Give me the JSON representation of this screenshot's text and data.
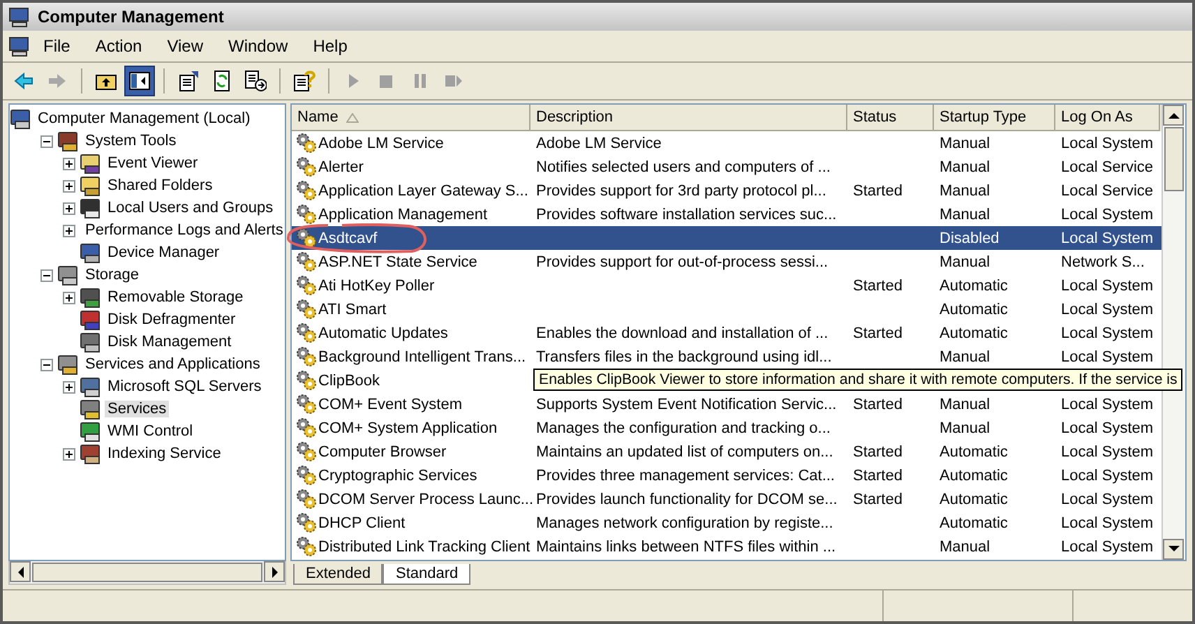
{
  "window": {
    "title": "Computer Management"
  },
  "menu": [
    "File",
    "Action",
    "View",
    "Window",
    "Help"
  ],
  "toolbar": [
    {
      "kind": "back",
      "disabled": false,
      "pressed": false
    },
    {
      "kind": "forward",
      "disabled": true,
      "pressed": false
    },
    {
      "kind": "sep"
    },
    {
      "kind": "up",
      "disabled": false,
      "pressed": false
    },
    {
      "kind": "tree",
      "disabled": false,
      "pressed": true
    },
    {
      "kind": "sep"
    },
    {
      "kind": "properties",
      "disabled": false,
      "pressed": false
    },
    {
      "kind": "refresh",
      "disabled": false,
      "pressed": false
    },
    {
      "kind": "export",
      "disabled": false,
      "pressed": false
    },
    {
      "kind": "sep"
    },
    {
      "kind": "help",
      "disabled": false,
      "pressed": false
    },
    {
      "kind": "sep"
    },
    {
      "kind": "play",
      "disabled": true,
      "pressed": false
    },
    {
      "kind": "stop",
      "disabled": true,
      "pressed": false
    },
    {
      "kind": "pause",
      "disabled": true,
      "pressed": false
    },
    {
      "kind": "restart",
      "disabled": true,
      "pressed": false
    }
  ],
  "tree": [
    {
      "label": "Computer Management (Local)",
      "kind": "computer",
      "selected": false,
      "children": [
        {
          "label": "System Tools",
          "kind": "tools",
          "expanded": true,
          "selected": false,
          "children": [
            {
              "label": "Event Viewer",
              "kind": "event",
              "expanded": false,
              "selected": false
            },
            {
              "label": "Shared Folders",
              "kind": "folder",
              "expanded": false,
              "selected": false
            },
            {
              "label": "Local Users and Groups",
              "kind": "users",
              "expanded": false,
              "selected": false
            },
            {
              "label": "Performance Logs and Alerts",
              "kind": "perf",
              "expanded": false,
              "selected": false
            },
            {
              "label": "Device Manager",
              "kind": "device",
              "selected": false
            }
          ]
        },
        {
          "label": "Storage",
          "kind": "storage",
          "expanded": true,
          "selected": false,
          "children": [
            {
              "label": "Removable Storage",
              "kind": "removable",
              "expanded": false,
              "selected": false
            },
            {
              "label": "Disk Defragmenter",
              "kind": "defrag",
              "selected": false
            },
            {
              "label": "Disk Management",
              "kind": "disk",
              "selected": false
            }
          ]
        },
        {
          "label": "Services and Applications",
          "kind": "apps",
          "expanded": true,
          "selected": false,
          "children": [
            {
              "label": "Microsoft SQL Servers",
              "kind": "sql",
              "expanded": false,
              "selected": false
            },
            {
              "label": "Services",
              "kind": "services",
              "selected": true
            },
            {
              "label": "WMI Control",
              "kind": "wmi",
              "selected": false
            },
            {
              "label": "Indexing Service",
              "kind": "index",
              "expanded": false,
              "selected": false
            }
          ]
        }
      ]
    }
  ],
  "table": {
    "columns": [
      {
        "label": "Name",
        "sorted": true
      },
      {
        "label": "Description",
        "sorted": false
      },
      {
        "label": "Status",
        "sorted": false
      },
      {
        "label": "Startup Type",
        "sorted": false
      },
      {
        "label": "Log On As",
        "sorted": false
      }
    ],
    "rows": [
      {
        "name": "Adobe LM Service",
        "description": "Adobe LM Service",
        "startup": "Manual",
        "logon": "Local System",
        "selected": false
      },
      {
        "name": "Alerter",
        "description": "Notifies selected users and computers of ...",
        "startup": "Manual",
        "logon": "Local Service",
        "selected": false
      },
      {
        "name": "Application Layer Gateway S...",
        "description": "Provides support for 3rd party protocol pl...",
        "status": "Started",
        "startup": "Manual",
        "logon": "Local Service",
        "selected": false
      },
      {
        "name": "Application Management",
        "description": "Provides software installation services suc...",
        "startup": "Manual",
        "logon": "Local System",
        "selected": false
      },
      {
        "name": "Asdtcavf",
        "startup": "Disabled",
        "logon": "Local System",
        "selected": true
      },
      {
        "name": "ASP.NET State Service",
        "description": "Provides support for out-of-process sessi...",
        "startup": "Manual",
        "logon": "Network S...",
        "selected": false
      },
      {
        "name": "Ati HotKey Poller",
        "status": "Started",
        "startup": "Automatic",
        "logon": "Local System",
        "selected": false
      },
      {
        "name": "ATI Smart",
        "startup": "Automatic",
        "logon": "Local System",
        "selected": false
      },
      {
        "name": "Automatic Updates",
        "description": "Enables the download and installation of ...",
        "status": "Started",
        "startup": "Automatic",
        "logon": "Local System",
        "selected": false
      },
      {
        "name": "Background Intelligent Trans...",
        "description": "Transfers files in the background using idl...",
        "startup": "Manual",
        "logon": "Local System",
        "selected": false
      },
      {
        "name": "ClipBook",
        "tooltip": "Enables ClipBook Viewer to store information and share it with remote computers. If the service is",
        "selected": false
      },
      {
        "name": "COM+ Event System",
        "description": "Supports System Event Notification Servic...",
        "status": "Started",
        "startup": "Manual",
        "logon": "Local System",
        "selected": false
      },
      {
        "name": "COM+ System Application",
        "description": "Manages the configuration and tracking o...",
        "startup": "Manual",
        "logon": "Local System",
        "selected": false
      },
      {
        "name": "Computer Browser",
        "description": "Maintains an updated list of computers on...",
        "status": "Started",
        "startup": "Automatic",
        "logon": "Local System",
        "selected": false
      },
      {
        "name": "Cryptographic Services",
        "description": "Provides three management services: Cat...",
        "status": "Started",
        "startup": "Automatic",
        "logon": "Local System",
        "selected": false
      },
      {
        "name": "DCOM Server Process Launc...",
        "description": "Provides launch functionality for DCOM se...",
        "status": "Started",
        "startup": "Automatic",
        "logon": "Local System",
        "selected": false
      },
      {
        "name": "DHCP Client",
        "description": "Manages network configuration by registe...",
        "startup": "Automatic",
        "logon": "Local System",
        "selected": false
      },
      {
        "name": "Distributed Link Tracking Client",
        "description": "Maintains links between NTFS files within ...",
        "startup": "Manual",
        "logon": "Local System",
        "selected": false
      }
    ]
  },
  "tabs": [
    {
      "label": "Extended",
      "selected": false
    },
    {
      "label": "Standard",
      "selected": true
    }
  ]
}
